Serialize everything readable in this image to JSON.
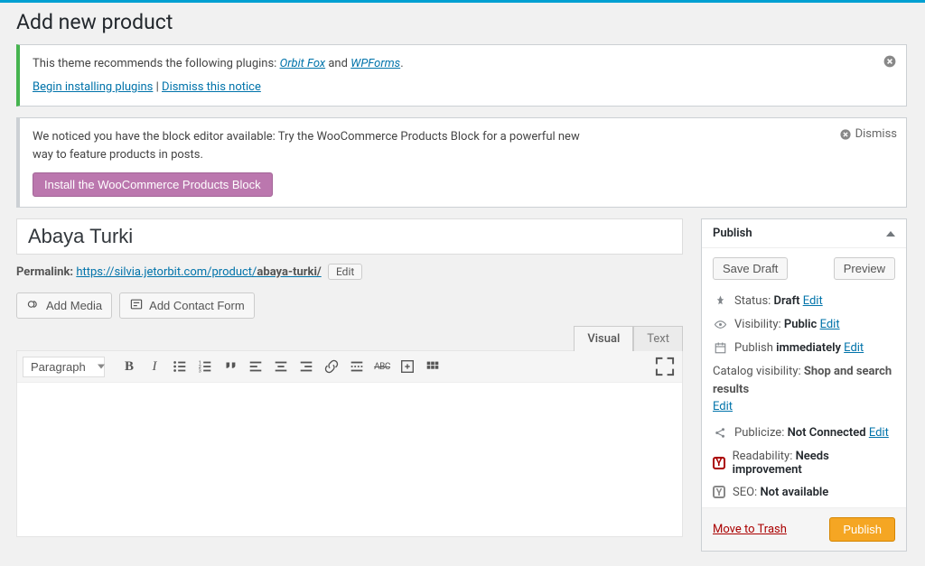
{
  "page_title": "Add new product",
  "notice_theme": {
    "text_prefix": "This theme recommends the following plugins: ",
    "plugin1": "Orbit Fox",
    "sep": " and ",
    "plugin2": "WPForms",
    "period": ".",
    "begin_link": "Begin installing plugins",
    "divider": " | ",
    "dismiss_link": "Dismiss this notice"
  },
  "notice_block": {
    "text": "We noticed you have the block editor available: Try the WooCommerce Products Block for a powerful new way to feature products in posts.",
    "dismiss": "Dismiss",
    "install_btn": "Install the WooCommerce Products Block"
  },
  "product": {
    "title": "Abaya Turki",
    "permalink_label": "Permalink:",
    "permalink_base": "https://silvia.jetorbit.com/product/",
    "permalink_slug": "abaya-turki/",
    "edit_btn": "Edit"
  },
  "media": {
    "add_media": "Add Media",
    "add_contact_form": "Add Contact Form"
  },
  "editor": {
    "tab_visual": "Visual",
    "tab_text": "Text",
    "format": "Paragraph"
  },
  "publish_box": {
    "header": "Publish",
    "save_draft": "Save Draft",
    "preview": "Preview",
    "status_label": "Status: ",
    "status_value": "Draft",
    "visibility_label": "Visibility: ",
    "visibility_value": "Public",
    "publish_label": "Publish ",
    "publish_value": "immediately",
    "catalog_label": "Catalog visibility: ",
    "catalog_value": "Shop and search results",
    "publicize_label": "Publicize: ",
    "publicize_value": "Not Connected",
    "readability_label": "Readability: ",
    "readability_value": "Needs improvement",
    "seo_label": "SEO: ",
    "seo_value": "Not available",
    "edit_link": "Edit",
    "trash": "Move to Trash",
    "publish_btn": "Publish"
  }
}
